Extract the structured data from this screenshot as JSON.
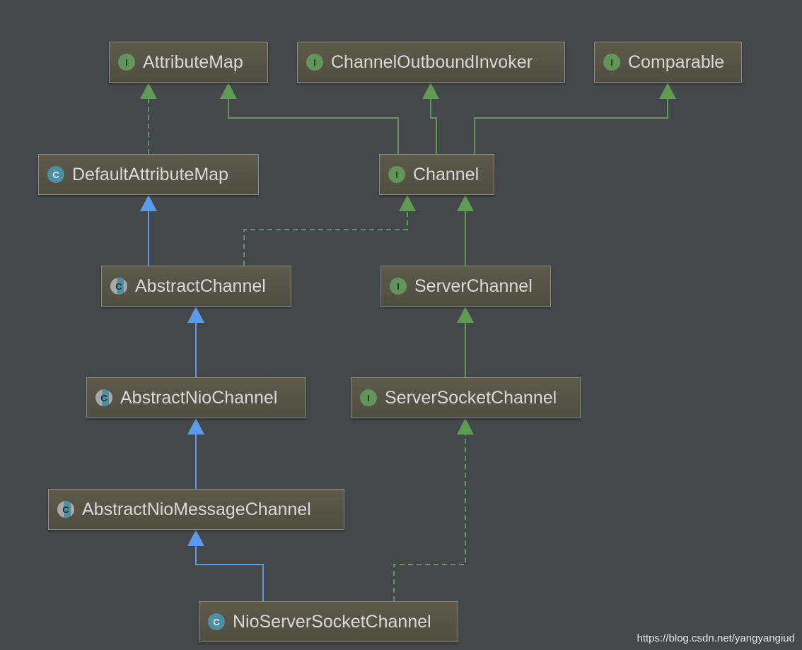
{
  "diagram": {
    "nodes": [
      {
        "id": "attributemap",
        "label": "AttributeMap",
        "kind": "interface",
        "badge": "I"
      },
      {
        "id": "outbound",
        "label": "ChannelOutboundInvoker",
        "kind": "interface",
        "badge": "I"
      },
      {
        "id": "comparable",
        "label": "Comparable",
        "kind": "interface",
        "badge": "I"
      },
      {
        "id": "defaultattrmap",
        "label": "DefaultAttributeMap",
        "kind": "class",
        "badge": "C"
      },
      {
        "id": "channel",
        "label": "Channel",
        "kind": "interface",
        "badge": "I"
      },
      {
        "id": "abstractchannel",
        "label": "AbstractChannel",
        "kind": "abstract-class",
        "badge": "C"
      },
      {
        "id": "serverchannel",
        "label": "ServerChannel",
        "kind": "interface",
        "badge": "I"
      },
      {
        "id": "abstractnio",
        "label": "AbstractNioChannel",
        "kind": "abstract-class",
        "badge": "C"
      },
      {
        "id": "serversocket",
        "label": "ServerSocketChannel",
        "kind": "interface",
        "badge": "I"
      },
      {
        "id": "abstractniomsg",
        "label": "AbstractNioMessageChannel",
        "kind": "abstract-class",
        "badge": "C"
      },
      {
        "id": "nioserversocket",
        "label": "NioServerSocketChannel",
        "kind": "class",
        "badge": "C"
      }
    ],
    "edges": [
      {
        "from": "defaultattrmap",
        "to": "attributemap",
        "type": "implements"
      },
      {
        "from": "channel",
        "to": "attributemap",
        "type": "interface-extends"
      },
      {
        "from": "channel",
        "to": "outbound",
        "type": "interface-extends"
      },
      {
        "from": "channel",
        "to": "comparable",
        "type": "interface-extends"
      },
      {
        "from": "abstractchannel",
        "to": "defaultattrmap",
        "type": "extends"
      },
      {
        "from": "abstractchannel",
        "to": "channel",
        "type": "implements"
      },
      {
        "from": "serverchannel",
        "to": "channel",
        "type": "interface-extends"
      },
      {
        "from": "abstractnio",
        "to": "abstractchannel",
        "type": "extends"
      },
      {
        "from": "serversocket",
        "to": "serverchannel",
        "type": "interface-extends"
      },
      {
        "from": "abstractniomsg",
        "to": "abstractnio",
        "type": "extends"
      },
      {
        "from": "nioserversocket",
        "to": "abstractniomsg",
        "type": "extends"
      },
      {
        "from": "nioserversocket",
        "to": "serversocket",
        "type": "implements"
      }
    ],
    "colors": {
      "background": "#45484b",
      "interface_edge": "#5f9b53",
      "class_edge": "#5b9bea",
      "node_border": "#8a8a86",
      "text": "#d8d8d8"
    }
  },
  "watermark": "https://blog.csdn.net/yangyangiud"
}
